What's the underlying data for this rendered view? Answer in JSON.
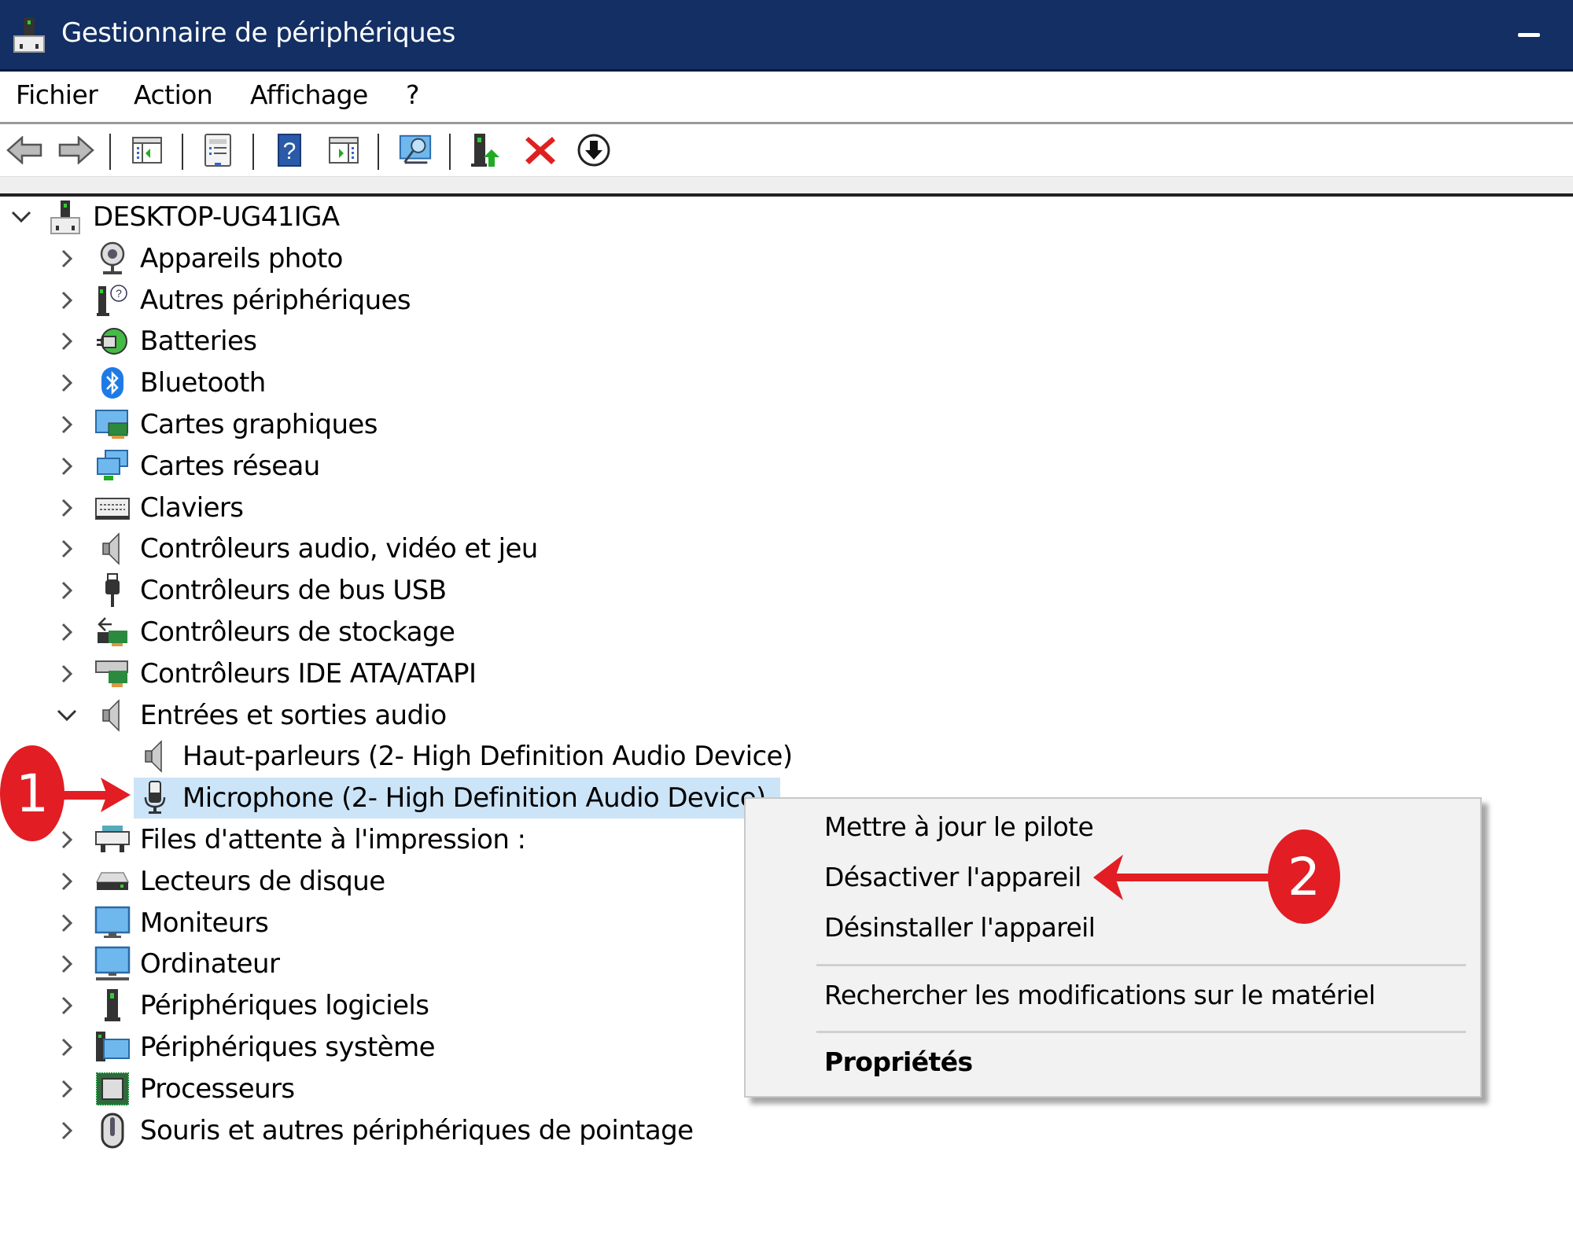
{
  "window": {
    "title": "Gestionnaire de périphériques",
    "title_icon": "device-manager-icon",
    "minimize_icon": "minimize-icon",
    "titlebar_color": "#132f63"
  },
  "menu": {
    "items": [
      "Fichier",
      "Action",
      "Affichage",
      "?"
    ]
  },
  "toolbar": {
    "buttons": [
      {
        "name": "back-icon"
      },
      {
        "name": "forward-icon"
      },
      {
        "name": "show-hide-console-tree-icon"
      },
      {
        "name": "properties-icon"
      },
      {
        "name": "help-icon"
      },
      {
        "name": "show-hide-action-pane-icon"
      },
      {
        "name": "scan-hardware-icon"
      },
      {
        "name": "update-driver-icon"
      },
      {
        "name": "uninstall-device-icon"
      },
      {
        "name": "disable-device-icon"
      }
    ]
  },
  "tree": {
    "root": {
      "label": "DESKTOP-UG41IGA",
      "expanded": true,
      "icon": "computer-root-icon"
    },
    "categories": [
      {
        "label": "Appareils photo",
        "icon": "camera-icon",
        "expanded": false
      },
      {
        "label": "Autres périphériques",
        "icon": "other-devices-icon",
        "expanded": false
      },
      {
        "label": "Batteries",
        "icon": "battery-icon",
        "expanded": false
      },
      {
        "label": "Bluetooth",
        "icon": "bluetooth-icon",
        "expanded": false
      },
      {
        "label": "Cartes graphiques",
        "icon": "display-adapter-icon",
        "expanded": false
      },
      {
        "label": "Cartes réseau",
        "icon": "network-adapter-icon",
        "expanded": false
      },
      {
        "label": "Claviers",
        "icon": "keyboard-icon",
        "expanded": false
      },
      {
        "label": "Contrôleurs audio, vidéo et jeu",
        "icon": "speaker-icon",
        "expanded": false
      },
      {
        "label": "Contrôleurs de bus USB",
        "icon": "usb-icon",
        "expanded": false
      },
      {
        "label": "Contrôleurs de stockage",
        "icon": "storage-controller-icon",
        "expanded": false
      },
      {
        "label": "Contrôleurs IDE ATA/ATAPI",
        "icon": "ide-controller-icon",
        "expanded": false
      },
      {
        "label": "Entrées et sorties audio",
        "icon": "speaker-icon",
        "expanded": true,
        "children": [
          {
            "label": "Haut-parleurs (2- High Definition Audio Device)",
            "icon": "speaker-icon",
            "selected": false
          },
          {
            "label": "Microphone (2- High Definition Audio Device)",
            "icon": "microphone-icon",
            "selected": true
          }
        ]
      },
      {
        "label": "Files d'attente à l'impression :",
        "icon": "printer-icon",
        "expanded": false
      },
      {
        "label": "Lecteurs de disque",
        "icon": "disk-drive-icon",
        "expanded": false
      },
      {
        "label": "Moniteurs",
        "icon": "monitor-icon",
        "expanded": false
      },
      {
        "label": "Ordinateur",
        "icon": "computer-icon",
        "expanded": false
      },
      {
        "label": "Périphériques logiciels",
        "icon": "software-device-icon",
        "expanded": false
      },
      {
        "label": "Périphériques système",
        "icon": "system-device-icon",
        "expanded": false
      },
      {
        "label": "Processeurs",
        "icon": "processor-icon",
        "expanded": false
      },
      {
        "label": "Souris et autres périphériques de pointage",
        "icon": "mouse-icon",
        "expanded": false
      }
    ]
  },
  "context_menu": {
    "items": [
      {
        "label": "Mettre à jour le pilote",
        "bold": false
      },
      {
        "label": "Désactiver l'appareil",
        "bold": false
      },
      {
        "label": "Désinstaller l'appareil",
        "bold": false
      },
      {
        "label": "Rechercher les modifications sur le matériel",
        "bold": false
      },
      {
        "label": "Propriétés",
        "bold": true
      }
    ]
  },
  "annotations": {
    "badge1": "1",
    "badge2": "2",
    "color": "#e21d24"
  }
}
